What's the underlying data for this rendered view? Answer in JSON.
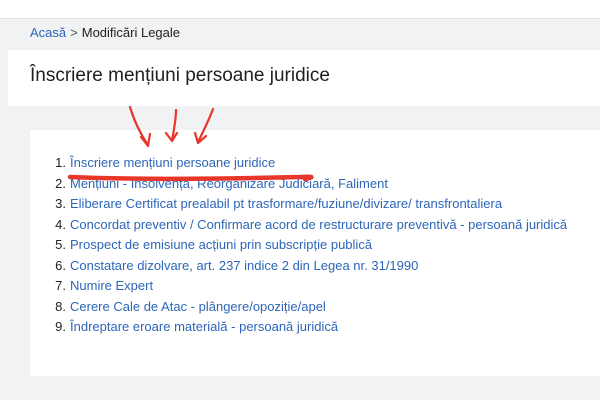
{
  "breadcrumb": {
    "home": "Acasă",
    "separator": ">",
    "current": "Modificări Legale"
  },
  "page": {
    "title": "Înscriere mențiuni persoane juridice"
  },
  "menu": {
    "items": [
      {
        "num": "1.",
        "label": "Înscriere mențiuni persoane juridice"
      },
      {
        "num": "2.",
        "label": "Mențiuni - Insolvență, Reorganizare Judiciară, Faliment"
      },
      {
        "num": "3.",
        "label": "Eliberare Certificat prealabil pt trasformare/fuziune/divizare/ transfrontaliera"
      },
      {
        "num": "4.",
        "label": "Concordat preventiv / Confirmare acord de restructurare preventivă - persoană juridică"
      },
      {
        "num": "5.",
        "label": "Prospect de emisiune acțiuni prin subscripție publică"
      },
      {
        "num": "6.",
        "label": "Constatare dizolvare, art. 237 indice 2 din Legea nr. 31/1990"
      },
      {
        "num": "7.",
        "label": "Numire Expert"
      },
      {
        "num": "8.",
        "label": "Cerere Cale de Atac - plângere/opoziție/apel"
      },
      {
        "num": "9.",
        "label": "Îndreptare eroare materială - persoană juridică"
      }
    ]
  },
  "colors": {
    "link": "#2d66b8",
    "annotation": "#e8362b",
    "background": "#f1f2f4"
  }
}
